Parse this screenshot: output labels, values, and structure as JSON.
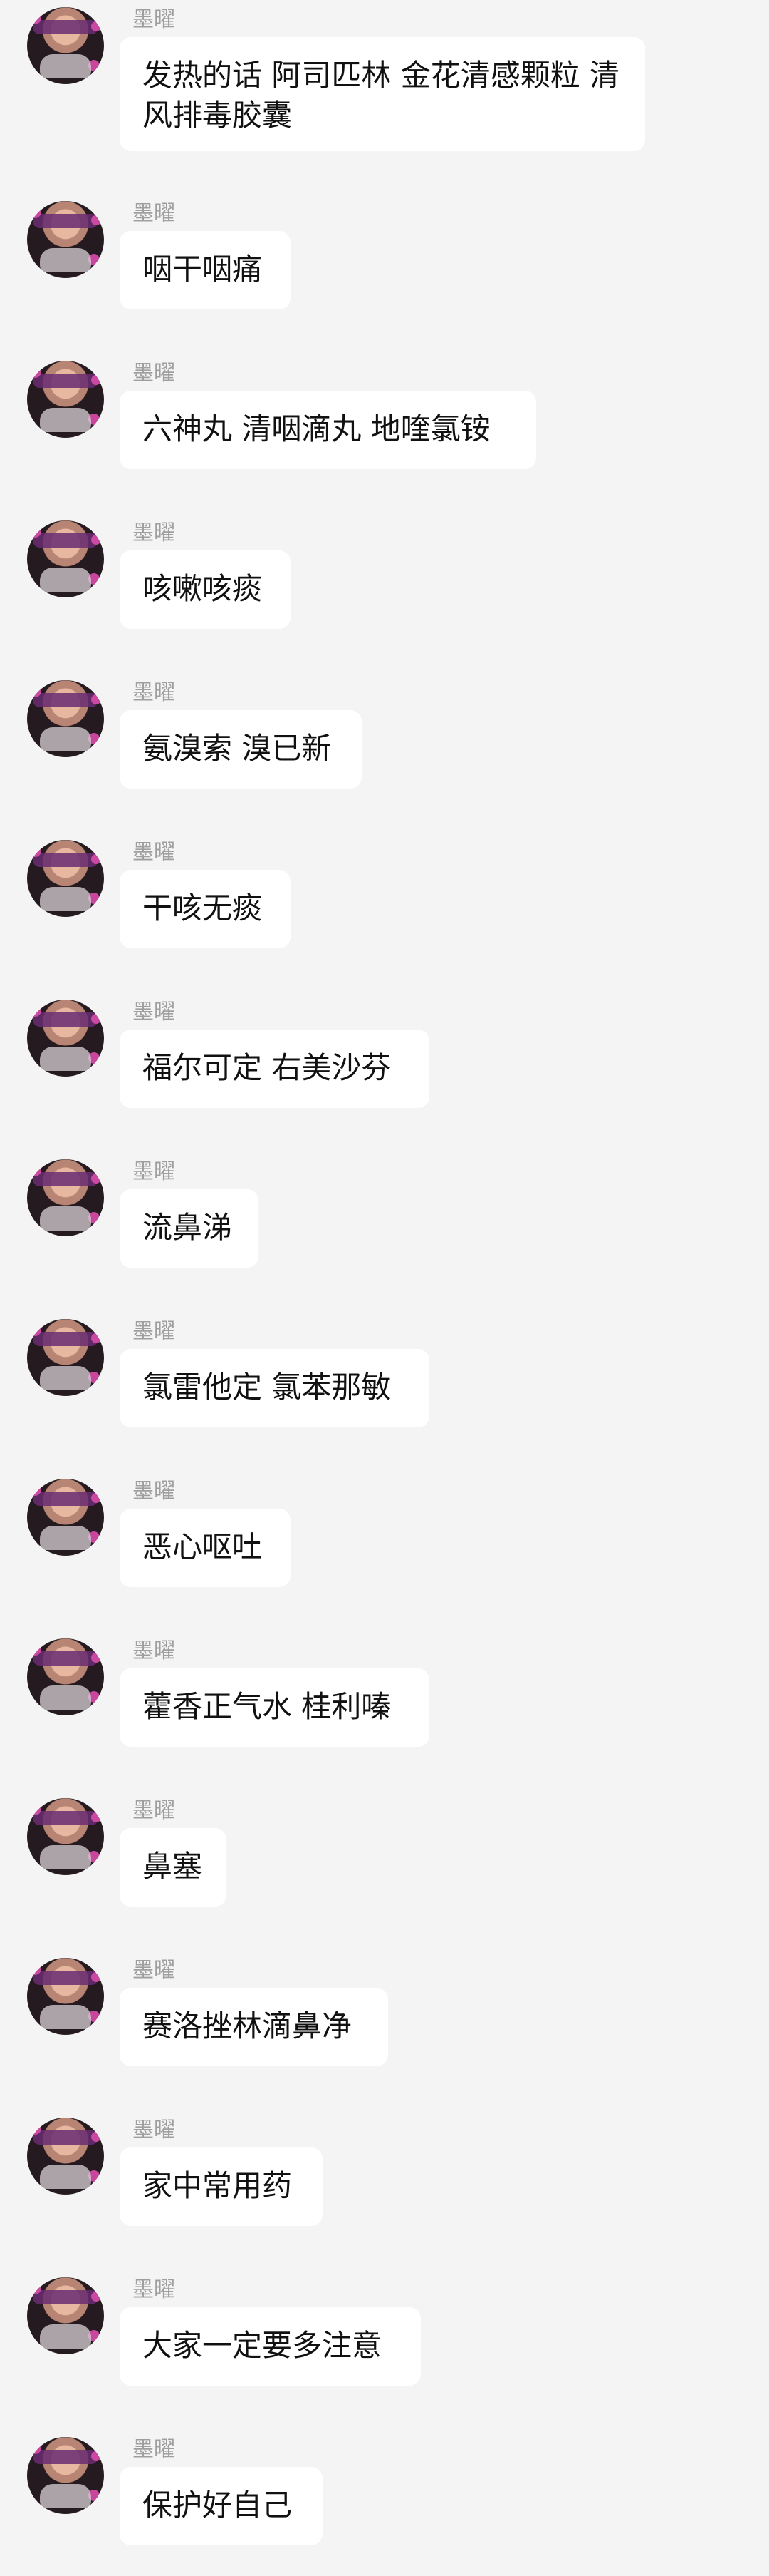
{
  "chat": {
    "messages": [
      {
        "sender": "墨曜",
        "text": "发热的话 阿司匹林 金花清感颗粒 清风排毒胶囊"
      },
      {
        "sender": "墨曜",
        "text": "咽干咽痛"
      },
      {
        "sender": "墨曜",
        "text": "六神丸 清咽滴丸 地喹氯铵"
      },
      {
        "sender": "墨曜",
        "text": "咳嗽咳痰"
      },
      {
        "sender": "墨曜",
        "text": "氨溴索 溴已新"
      },
      {
        "sender": "墨曜",
        "text": "干咳无痰"
      },
      {
        "sender": "墨曜",
        "text": "福尔可定 右美沙芬"
      },
      {
        "sender": "墨曜",
        "text": "流鼻涕"
      },
      {
        "sender": "墨曜",
        "text": "氯雷他定 氯苯那敏"
      },
      {
        "sender": "墨曜",
        "text": "恶心呕吐"
      },
      {
        "sender": "墨曜",
        "text": "藿香正气水 桂利嗪"
      },
      {
        "sender": "墨曜",
        "text": "鼻塞"
      },
      {
        "sender": "墨曜",
        "text": "赛洛挫林滴鼻净"
      },
      {
        "sender": "墨曜",
        "text": "家中常用药"
      },
      {
        "sender": "墨曜",
        "text": "大家一定要多注意"
      },
      {
        "sender": "墨曜",
        "text": "保护好自己"
      }
    ]
  }
}
